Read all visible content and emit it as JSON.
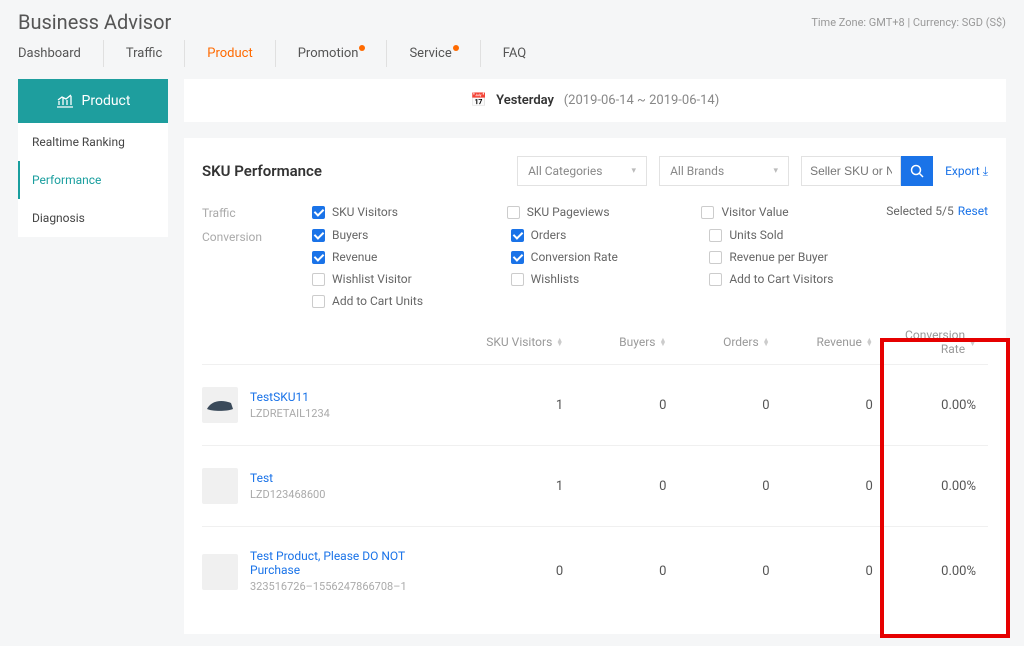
{
  "header": {
    "title": "Business Advisor",
    "timezone": "Time Zone: GMT+8 | Currency: SGD (S$)"
  },
  "nav": {
    "dashboard": "Dashboard",
    "traffic": "Traffic",
    "product": "Product",
    "promotion": "Promotion",
    "service": "Service",
    "faq": "FAQ"
  },
  "sidebar": {
    "head": "Product",
    "items": [
      "Realtime Ranking",
      "Performance",
      "Diagnosis"
    ]
  },
  "date": {
    "label": "Yesterday",
    "range": "(2019-06-14 ~ 2019-06-14)"
  },
  "panel": {
    "title": "SKU Performance",
    "cat_sel": "All Categories",
    "brand_sel": "All Brands",
    "search_ph": "Seller SKU or Name",
    "export": "Export ⤓",
    "selected": "Selected 5/5",
    "reset": "Reset"
  },
  "metric_groups": {
    "traffic": "Traffic",
    "conversion": "Conversion"
  },
  "metrics": {
    "sku_visitors": "SKU Visitors",
    "sku_pageviews": "SKU Pageviews",
    "visitor_value": "Visitor Value",
    "buyers": "Buyers",
    "orders": "Orders",
    "units_sold": "Units Sold",
    "revenue": "Revenue",
    "conversion_rate": "Conversion Rate",
    "rev_per_buyer": "Revenue per Buyer",
    "wishlist_visitor": "Wishlist Visitor",
    "wishlists": "Wishlists",
    "add_cart_visitors": "Add to Cart Visitors",
    "add_cart_units": "Add to Cart Units"
  },
  "cols": {
    "sku_visitors": "SKU Visitors",
    "buyers": "Buyers",
    "orders": "Orders",
    "revenue": "Revenue",
    "conversion_rate": "Conversion Rate"
  },
  "rows": [
    {
      "name": "TestSKU11",
      "code": "LZDRETAIL1234",
      "v": [
        "1",
        "0",
        "0",
        "0",
        "0.00%"
      ]
    },
    {
      "name": "Test",
      "code": "LZD123468600",
      "v": [
        "1",
        "0",
        "0",
        "0",
        "0.00%"
      ]
    },
    {
      "name": "Test Product, Please DO NOT Purchase",
      "code": "323516726–1556247866708–1",
      "v": [
        "0",
        "0",
        "0",
        "0",
        "0.00%"
      ]
    }
  ]
}
